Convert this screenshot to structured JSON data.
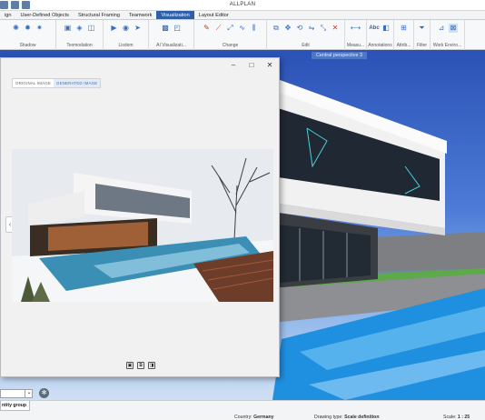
{
  "app": {
    "title": "ALLPLAN"
  },
  "tabs": [
    "ign",
    "User-Defined Objects",
    "Structural Framing",
    "Teamwork",
    "Visualization",
    "Layout Editor"
  ],
  "active_tab": "Visualization",
  "ribbon_groups": [
    {
      "label": "Shadow"
    },
    {
      "label": "Texmodation"
    },
    {
      "label": "Lisdom"
    },
    {
      "label": "AI Visualizati..."
    },
    {
      "label": "Change"
    },
    {
      "label": "Edit"
    },
    {
      "label": "Measu..."
    },
    {
      "label": "Annotations"
    },
    {
      "label": "Attrib..."
    },
    {
      "label": "Filter"
    },
    {
      "label": "Work Enviro..."
    }
  ],
  "viewport": {
    "label": "Central perspective 3"
  },
  "dialog": {
    "toggle_original": "ORIGINAL IMAGE",
    "toggle_generated": "GENERATED IMAGE",
    "active_toggle": "GENERATED IMAGE"
  },
  "left_panel": {
    "tab": "ntity group"
  },
  "status": {
    "country_label": "Country:",
    "country_value": "Germany",
    "drawing_type_label": "Drawing type:",
    "drawing_type_value": "Scale definition",
    "scale_label": "Scale:",
    "scale_value": "1 : 25"
  },
  "colors": {
    "accent": "#2f5fa7",
    "sky": "#3a66c4",
    "pool": "#1f8fe0"
  }
}
